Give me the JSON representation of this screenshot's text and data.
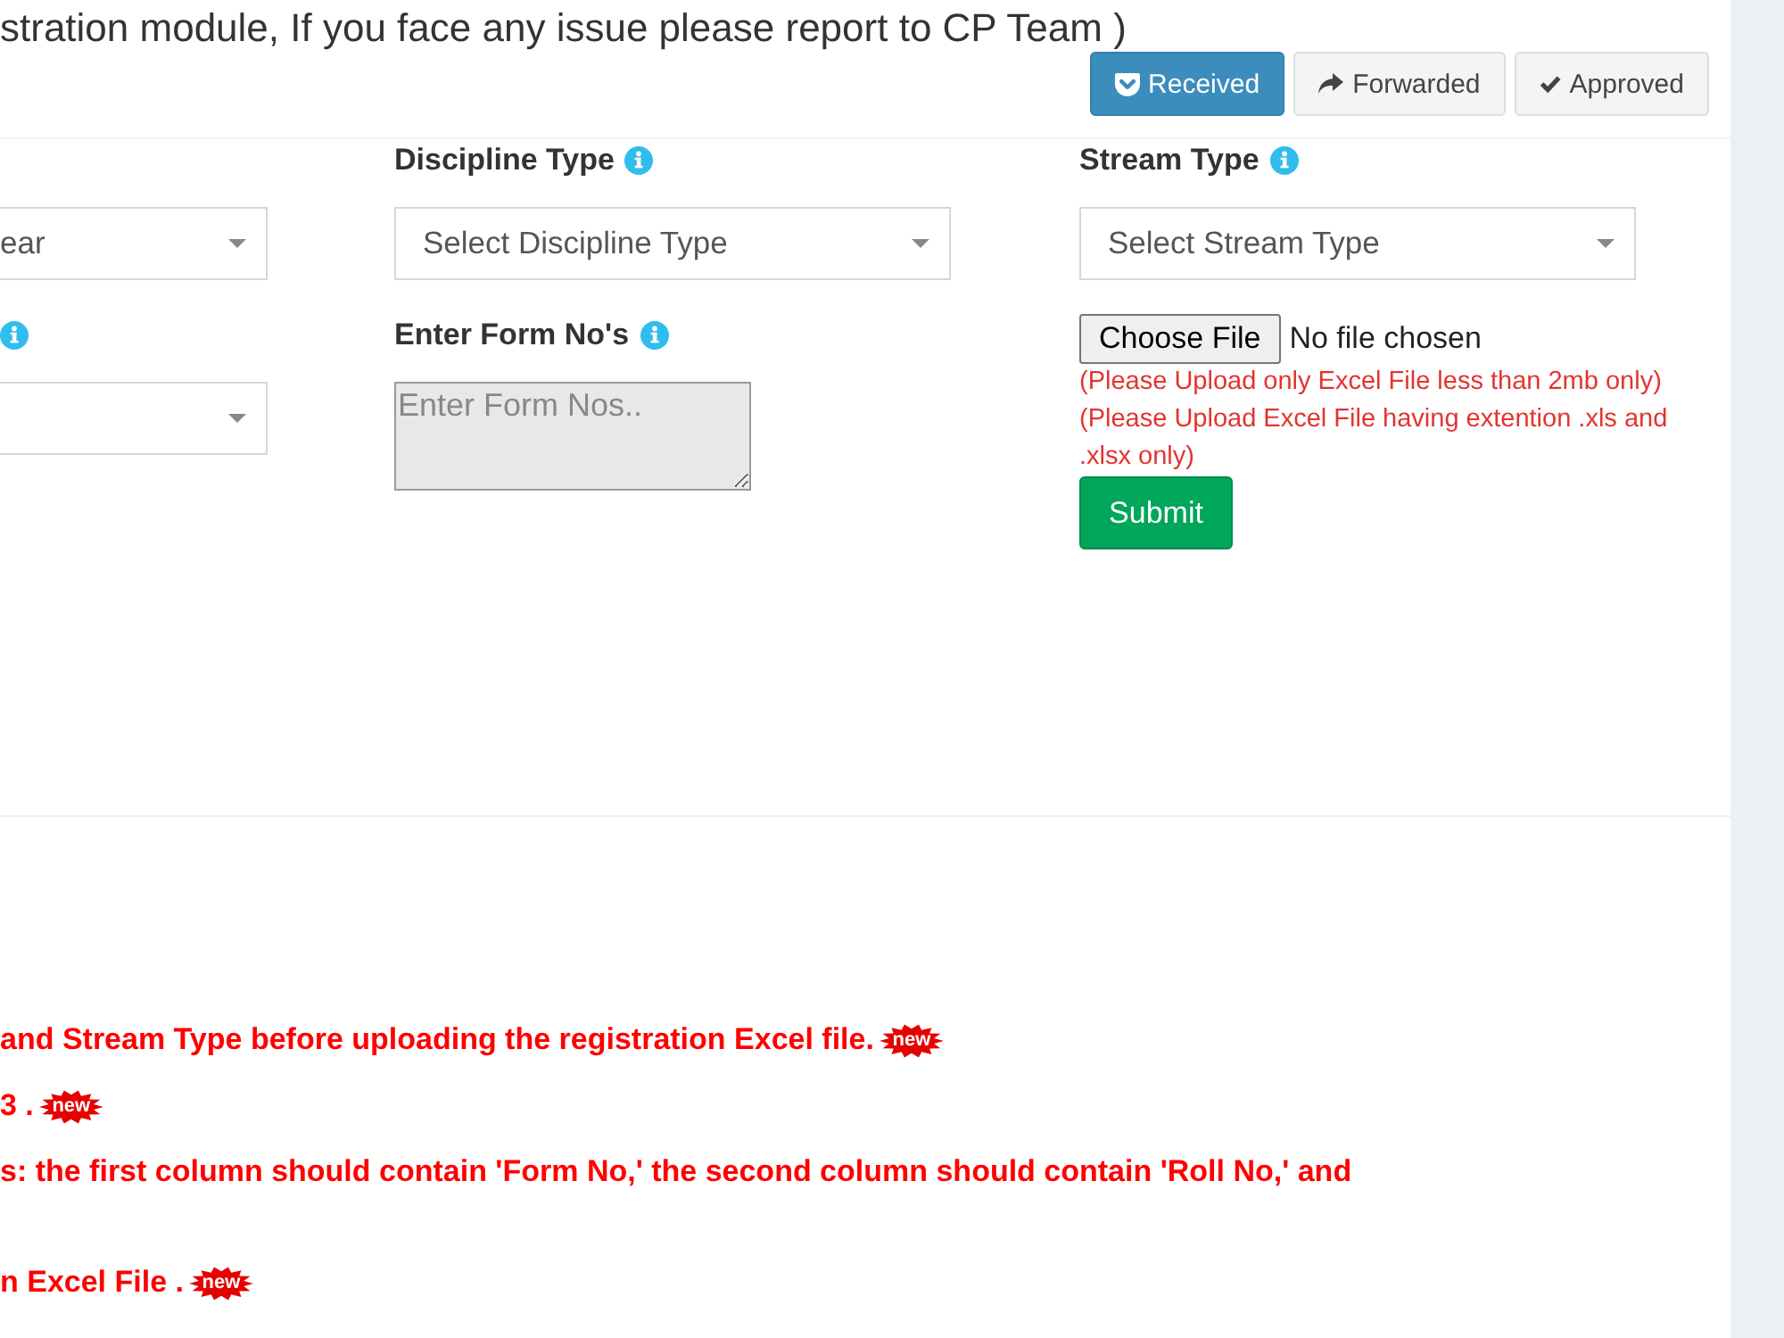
{
  "notice": {
    "text": "stration module, If you face any issue please report to CP Team )"
  },
  "tabs": [
    {
      "label": "Received",
      "selected": true
    },
    {
      "label": "Forwarded",
      "selected": false
    },
    {
      "label": "Approved",
      "selected": false
    }
  ],
  "form": {
    "columns": [
      {
        "fields": [
          {
            "kind": "select",
            "value": "ear"
          },
          {
            "kind": "select",
            "info_icon": true
          }
        ]
      },
      {
        "fields": [
          {
            "kind": "select",
            "label": "Discipline Type",
            "info_icon": true,
            "value": "Select Discipline Type"
          },
          {
            "kind": "textarea",
            "label": "Enter Form No's",
            "info_icon": true,
            "placeholder": "Enter Form Nos.."
          }
        ]
      },
      {
        "fields": [
          {
            "kind": "select",
            "label": "Stream Type",
            "info_icon": true,
            "value": "Select Stream Type"
          },
          {
            "kind": "file",
            "button": "Choose File",
            "status": "No file chosen",
            "hints": [
              "(Please Upload only Excel File less than 2mb only)",
              "(Please Upload Excel File having extention .xls and .xlsx only)"
            ],
            "submit": "Submit"
          }
        ]
      }
    ]
  },
  "notes": [
    {
      "text": "and Stream Type before uploading the registration Excel file.",
      "badge": "new"
    },
    {
      "text": "3 .",
      "badge": "new"
    },
    {
      "text": "s: the first column should contain 'Form No,' the second column should contain 'Roll No,' and"
    },
    {
      "text": "n Excel File .",
      "badge": "new"
    }
  ]
}
